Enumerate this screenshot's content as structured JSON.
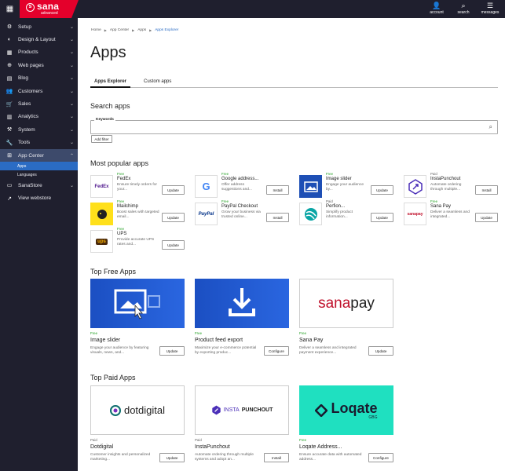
{
  "topbar": {
    "logo_text": "sana",
    "logo_sub": "advanced",
    "actions": [
      {
        "icon": "account-icon",
        "glyph": "👤",
        "label": "account"
      },
      {
        "icon": "search-icon",
        "glyph": "⌕",
        "label": "search"
      },
      {
        "icon": "messages-icon",
        "glyph": "☰",
        "label": "messages"
      }
    ]
  },
  "sidebar": {
    "items": [
      {
        "label": "Setup",
        "glyph": "⚙"
      },
      {
        "label": "Design & Layout",
        "glyph": "◐"
      },
      {
        "label": "Products",
        "glyph": "▦"
      },
      {
        "label": "Web pages",
        "glyph": "⊕"
      },
      {
        "label": "Blog",
        "glyph": "▤"
      },
      {
        "label": "Customers",
        "glyph": "👥"
      },
      {
        "label": "Sales",
        "glyph": "🛒"
      },
      {
        "label": "Analytics",
        "glyph": "▥"
      },
      {
        "label": "System",
        "glyph": "⚒"
      },
      {
        "label": "Tools",
        "glyph": "🔧"
      },
      {
        "label": "App Center",
        "glyph": "⊞"
      },
      {
        "label": "SanaStore",
        "glyph": "▭"
      },
      {
        "label": "View webstore",
        "glyph": "↗"
      }
    ],
    "subitems": [
      "Apps",
      "Languages"
    ]
  },
  "breadcrumb": [
    "Home",
    "App Center",
    "Apps",
    "Apps Explorer"
  ],
  "page_title": "Apps",
  "tabs": [
    "Apps Explorer",
    "Custom apps"
  ],
  "search": {
    "title": "Search apps",
    "label": "Keywords",
    "add_filter": "Add filter"
  },
  "popular": {
    "title": "Most popular apps",
    "apps": [
      {
        "tier": "Free",
        "name": "FedEx",
        "desc": "Ensure timely orders for your...",
        "button": "Update"
      },
      {
        "tier": "Free",
        "name": "Google address...",
        "desc": "Offer address suggestions and...",
        "button": "Install"
      },
      {
        "tier": "Free",
        "name": "Image slider",
        "desc": "Engage your audience by...",
        "button": "Update"
      },
      {
        "tier": "Paid",
        "name": "InstaPunchout",
        "desc": "Automate ordering through multiple...",
        "button": "Install"
      },
      {
        "tier": "Free",
        "name": "Mailchimp",
        "desc": "Boost sales with targeted email...",
        "button": "Update"
      },
      {
        "tier": "Free",
        "name": "PayPal Checkout",
        "desc": "Grow your business via trusted online...",
        "button": "Install"
      },
      {
        "tier": "Paid",
        "name": "Perfion...",
        "desc": "Simplify product information...",
        "button": "Update"
      },
      {
        "tier": "Free",
        "name": "Sana Pay",
        "desc": "Deliver a seamless and integrated...",
        "button": "Update"
      },
      {
        "tier": "Free",
        "name": "UPS",
        "desc": "Provide accurate UPS rates and...",
        "button": "Update"
      }
    ],
    "logo_texts": {
      "fedex": "FedEx",
      "google": "G",
      "sanapay": "sanapay",
      "paypal": "PayPal",
      "ups": "ups"
    }
  },
  "top_free": {
    "title": "Top Free Apps",
    "apps": [
      {
        "tier": "Free",
        "name": "Image slider",
        "desc": "Engage your audience by featuring visuals, news, and...",
        "button": "Update"
      },
      {
        "tier": "Free",
        "name": "Product feed export",
        "desc": "Maximize your e-commerce potential by exporting produc...",
        "button": "Configure"
      },
      {
        "tier": "Free",
        "name": "Sana Pay",
        "desc": "Deliver a seamless and integrated payment experience...",
        "button": "Update"
      }
    ],
    "logo_texts": {
      "sanapay_a": "sana",
      "sanapay_b": "pay"
    }
  },
  "top_paid": {
    "title": "Top Paid Apps",
    "apps": [
      {
        "tier": "Paid",
        "name": "Dotdigital",
        "desc": "Customer insights and personalized marketing...",
        "button": "Update"
      },
      {
        "tier": "Paid",
        "name": "InstaPunchout",
        "desc": "Automate ordering through multiple systems and adopt an...",
        "button": "Install"
      },
      {
        "tier": "Free",
        "name": "Loqate Address...",
        "desc": "Ensure accurate data with automated address...",
        "button": "Configure"
      }
    ],
    "logo_texts": {
      "dotdigital": "dotdigital",
      "insta_a": "INSTA",
      "insta_b": "PUNCHOUT",
      "loqate": "Loqate",
      "gbg": "GBG"
    }
  },
  "colors": {
    "accent": "#e4002b",
    "sidebar": "#1f1f2e",
    "selected": "#2b6cc4",
    "free": "#1a9c1a"
  }
}
